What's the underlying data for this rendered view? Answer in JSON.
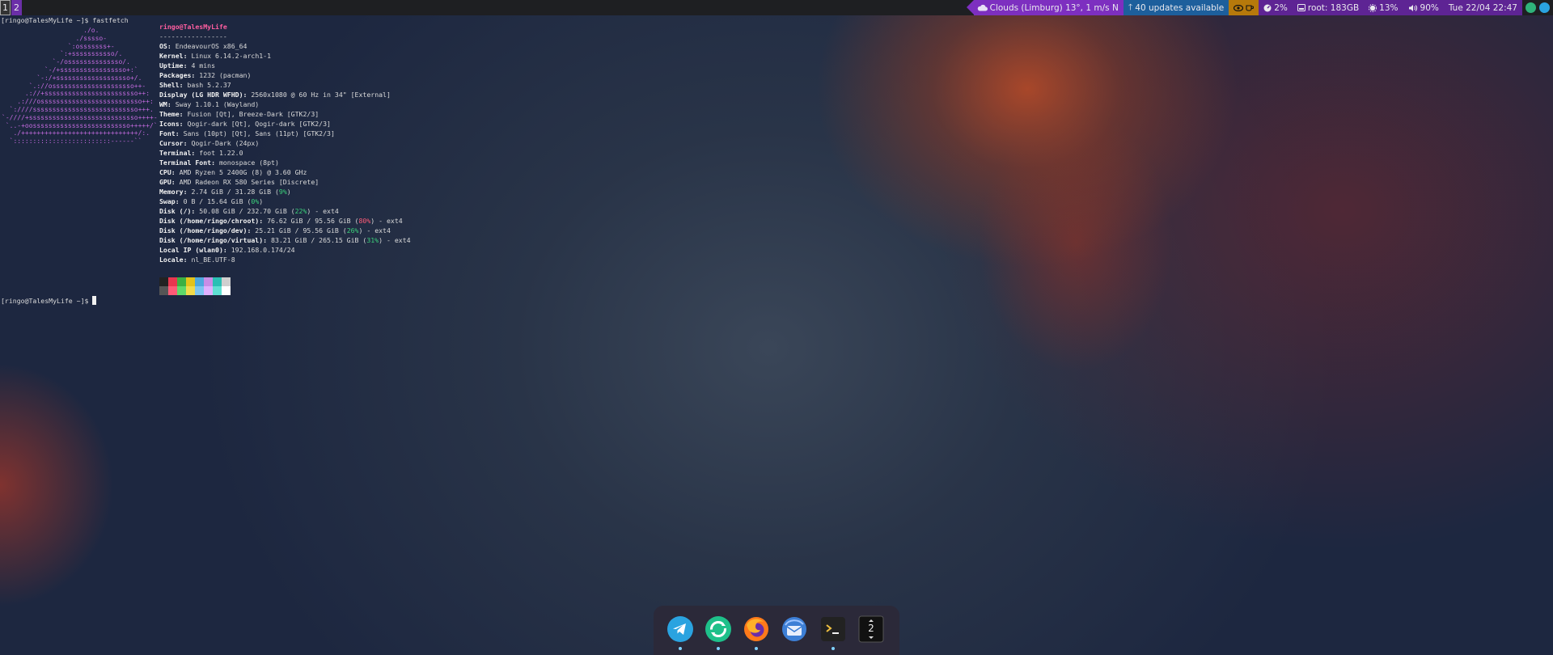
{
  "workspaces": [
    "1",
    "2"
  ],
  "bar": {
    "weather": "Clouds (Limburg) 13°,  1 m/s N",
    "updates": "40 updates available",
    "cpu": "2%",
    "disk": "root: 183GB",
    "brightness": "13%",
    "volume": "90%",
    "clock": "Tue 22/04 22:47"
  },
  "terminal": {
    "command_line": "[ringo@TalesMyLife ~]$ fastfetch",
    "prompt": "[ringo@TalesMyLife ~]$ ",
    "user_host": "ringo@TalesMyLife",
    "separator": "-----------------",
    "info": [
      {
        "key": "OS",
        "value": "EndeavourOS x86_64"
      },
      {
        "key": "Kernel",
        "value": "Linux 6.14.2-arch1-1"
      },
      {
        "key": "Uptime",
        "value": "4 mins"
      },
      {
        "key": "Packages",
        "value": "1232 (pacman)"
      },
      {
        "key": "Shell",
        "value": "bash 5.2.37"
      },
      {
        "key": "Display (LG HDR WFHD)",
        "value": "2560x1080 @ 60 Hz in 34\" [External]"
      },
      {
        "key": "WM",
        "value": "Sway 1.10.1 (Wayland)"
      },
      {
        "key": "Theme",
        "value": "Fusion [Qt], Breeze-Dark [GTK2/3]"
      },
      {
        "key": "Icons",
        "value": "Qogir-dark [Qt], Qogir-dark [GTK2/3]"
      },
      {
        "key": "Font",
        "value": "Sans (10pt) [Qt], Sans (11pt) [GTK2/3]"
      },
      {
        "key": "Cursor",
        "value": "Qogir-Dark (24px)"
      },
      {
        "key": "Terminal",
        "value": "foot 1.22.0"
      },
      {
        "key": "Terminal Font",
        "value": "monospace (8pt)"
      },
      {
        "key": "CPU",
        "value": "AMD Ryzen 5 2400G (8) @ 3.60 GHz"
      },
      {
        "key": "GPU",
        "value": "AMD Radeon RX 580 Series [Discrete]"
      },
      {
        "key": "Memory",
        "value": "2.74 GiB / 31.28 GiB (",
        "pct": "9%",
        "tail": ")"
      },
      {
        "key": "Swap",
        "value": "0 B / 15.64 GiB (",
        "pct": "0%",
        "tail": ")"
      },
      {
        "key": "Disk (/)",
        "value": "50.08 GiB / 232.70 GiB (",
        "pct": "22%",
        "tail": ") - ext4"
      },
      {
        "key": "Disk (/home/ringo/chroot)",
        "value": "76.62 GiB / 95.56 GiB (",
        "pct": "80%",
        "tail": ") - ext4",
        "warn": true
      },
      {
        "key": "Disk (/home/ringo/dev)",
        "value": "25.21 GiB / 95.56 GiB (",
        "pct": "26%",
        "tail": ") - ext4"
      },
      {
        "key": "Disk (/home/ringo/virtual)",
        "value": "83.21 GiB / 265.15 GiB (",
        "pct": "31%",
        "tail": ") - ext4"
      },
      {
        "key": "Local IP (wlan0)",
        "value": "192.168.0.174/24"
      },
      {
        "key": "Locale",
        "value": "nl_BE.UTF-8"
      }
    ],
    "palette": [
      "#222222",
      "#e8364f",
      "#3cb043",
      "#e5c31a",
      "#4ea8de",
      "#c98de6",
      "#2ac0b4",
      "#cfcfcf",
      "#555555",
      "#ff5a77",
      "#5fd86a",
      "#f2da4a",
      "#7cc4f0",
      "#e0b0ff",
      "#5fe0d2",
      "#ffffff"
    ]
  },
  "dock": {
    "items": [
      {
        "name": "telegram-icon",
        "color": "#2aa3e0"
      },
      {
        "name": "sync-app-icon",
        "color": "#1ec08a"
      },
      {
        "name": "firefox-icon",
        "color": "#ff7a1a"
      },
      {
        "name": "thunderbird-icon",
        "color": "#3d7fd6"
      },
      {
        "name": "terminal-icon",
        "color": "#222222"
      },
      {
        "name": "workspace-switcher",
        "label": "2"
      }
    ]
  },
  "colors": {
    "bar_bg": "#1e1f22",
    "weather_bg": "#7d2fc0",
    "updates_bg": "#1d5f9c",
    "idle_bg": "#b6790b",
    "status_bg": "#5e2494"
  }
}
